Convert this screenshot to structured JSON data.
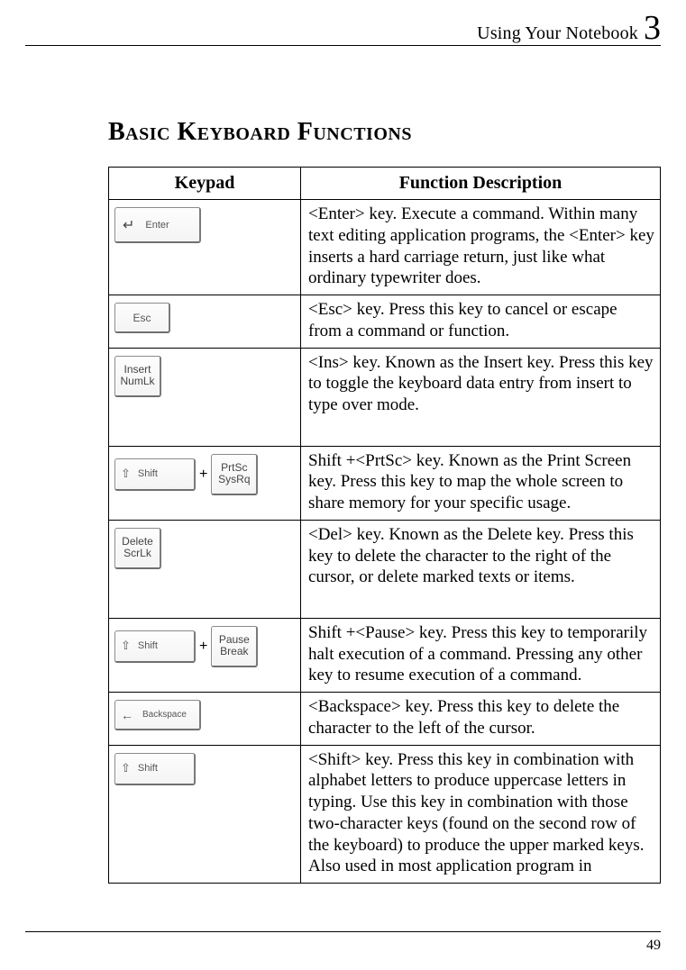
{
  "header": {
    "running_title": "Using Your Notebook",
    "chapter_number": "3"
  },
  "section_title": "Basic Keyboard Functions",
  "table": {
    "head": {
      "col1": "Keypad",
      "col2": "Function Description"
    },
    "rows": [
      {
        "key": {
          "type": "enter",
          "label": "Enter"
        },
        "desc": "<Enter> key. Execute a command. Within many text editing application programs, the <Enter> key inserts a hard carriage return, just like what ordinary typewriter does."
      },
      {
        "key": {
          "type": "esc",
          "label": "Esc"
        },
        "desc": "<Esc> key. Press this key to cancel or escape from a command or function."
      },
      {
        "key": {
          "type": "square",
          "line1": "Insert",
          "line2": "NumLk"
        },
        "desc": "<Ins> key. Known as the Insert key. Press this key to toggle the keyboard data entry from insert to type over mode."
      },
      {
        "key": {
          "type": "combo",
          "left": {
            "type": "shift",
            "label": "Shift"
          },
          "right": {
            "type": "square",
            "line1": "PrtSc",
            "line2": "SysRq"
          }
        },
        "desc": "Shift +<PrtSc> key. Known as the Print Screen key. Press this key to map the whole screen to share memory for your specific usage."
      },
      {
        "key": {
          "type": "square",
          "line1": "Delete",
          "line2": "ScrLk"
        },
        "desc": "<Del> key. Known as the Delete key. Press this key to delete the character to the right of the cursor, or delete marked texts or items."
      },
      {
        "key": {
          "type": "combo",
          "left": {
            "type": "shift",
            "label": "Shift"
          },
          "right": {
            "type": "square",
            "line1": "Pause",
            "line2": "Break"
          }
        },
        "desc": "Shift +<Pause> key. Press this key to temporarily halt execution of a command. Pressing any other key to resume execution of a command."
      },
      {
        "key": {
          "type": "backspace",
          "label": "Backspace"
        },
        "desc": "<Backspace> key. Press this key to delete the character to the left of the cursor."
      },
      {
        "key": {
          "type": "shift",
          "label": "Shift"
        },
        "desc": "<Shift> key. Press this key in combination with alphabet letters to produce uppercase letters in typing. Use this key in combination with those two-character keys (found on the second row of the keyboard) to produce the upper marked keys. Also used in most application program in"
      }
    ]
  },
  "page_number": "49"
}
